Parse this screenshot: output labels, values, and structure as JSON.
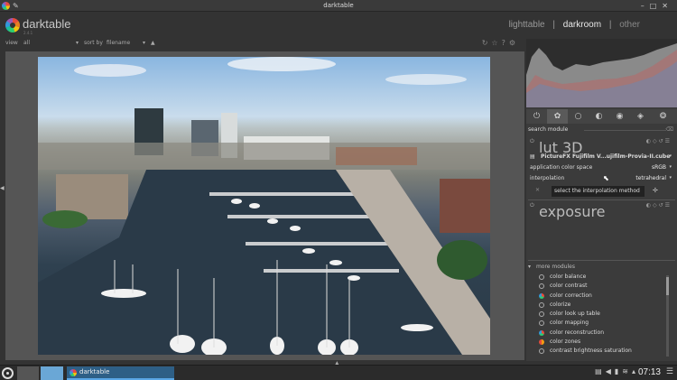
{
  "window": {
    "title": "darktable"
  },
  "header": {
    "brand": "darktable",
    "version": "2.4.1",
    "views": {
      "lighttable": "lighttable",
      "sep1": "|",
      "darkroom": "darkroom",
      "sep2": "|",
      "other": "other"
    }
  },
  "filterbar": {
    "view_label": "view",
    "view_value": "all",
    "sort_label": "sort by",
    "sort_value": "filename"
  },
  "right_panel": {
    "search_label": "search module",
    "lut3d": {
      "title": "lut 3D",
      "file_value": "PictureFX Fujifilm V...ujifilm-Provia-II.cube",
      "colorspace_label": "application color space",
      "colorspace_value": "sRGB",
      "interp_label": "interpolation",
      "interp_value": "tetrahedral",
      "tooltip": "select the interpolation method"
    },
    "exposure": {
      "title": "exposure"
    },
    "more_modules": {
      "title": "more modules",
      "items": [
        {
          "label": "color balance",
          "icon": "circle-icon"
        },
        {
          "label": "color contrast",
          "icon": "circle-icon"
        },
        {
          "label": "color correction",
          "icon": "color-wheel-icon"
        },
        {
          "label": "colorize",
          "icon": "circle-icon"
        },
        {
          "label": "color look up table",
          "icon": "circle-icon"
        },
        {
          "label": "color mapping",
          "icon": "circle-icon"
        },
        {
          "label": "color reconstruction",
          "icon": "color-wheel-icon"
        },
        {
          "label": "color zones",
          "icon": "color-warm-icon"
        },
        {
          "label": "contrast brightness saturation",
          "icon": "circle-icon"
        }
      ]
    }
  },
  "taskbar": {
    "task_label": "darktable",
    "clock": "07:13"
  },
  "colors": {
    "accent": "#5aa7e6",
    "panel_bg": "#3b3b3b",
    "background": "#333333"
  }
}
